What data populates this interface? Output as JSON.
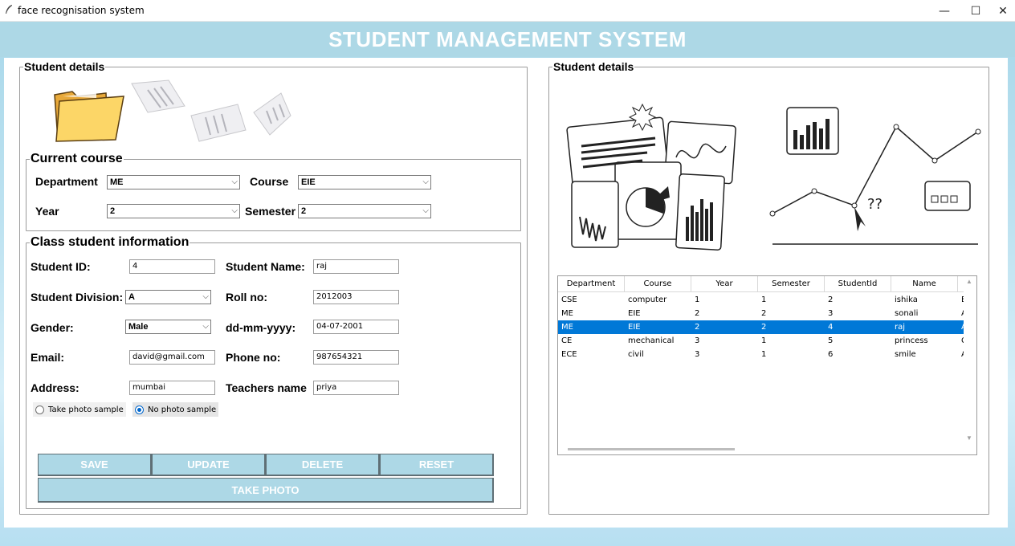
{
  "window": {
    "title": "face recognisation system",
    "controls": {
      "minimize": "—",
      "maximize": "☐",
      "close": "✕"
    }
  },
  "header": {
    "title": "STUDENT MANAGEMENT SYSTEM"
  },
  "left_panel": {
    "legend": "Student details",
    "current_course": {
      "legend": "Current course",
      "department_label": "Department",
      "department_value": "ME",
      "course_label": "Course",
      "course_value": "EIE",
      "year_label": "Year",
      "year_value": "2",
      "semester_label": "Semester",
      "semester_value": "2"
    },
    "class_info": {
      "legend": "Class student information",
      "student_id_label": "Student ID:",
      "student_id_value": "4",
      "student_name_label": "Student Name:",
      "student_name_value": "raj",
      "division_label": "Student Division:",
      "division_value": "A",
      "roll_label": "Roll no:",
      "roll_value": "2012003",
      "gender_label": "Gender:",
      "gender_value": "Male",
      "dob_label": "dd-mm-yyyy:",
      "dob_value": "04-07-2001",
      "email_label": "Email:",
      "email_value": "david@gmail.com",
      "phone_label": "Phone no:",
      "phone_value": "987654321",
      "address_label": "Address:",
      "address_value": "mumbai",
      "teacher_label": "Teachers name",
      "teacher_value": "priya",
      "radio_take": "Take photo sample",
      "radio_no": "No photo sample",
      "selected_radio": "No photo sample"
    },
    "buttons": {
      "save": "SAVE",
      "update": "UPDATE",
      "delete": "DELETE",
      "reset": "RESET",
      "take_photo": "TAKE PHOTO"
    }
  },
  "right_panel": {
    "legend": "Student details",
    "table": {
      "columns": [
        "Department",
        "Course",
        "Year",
        "Semester",
        "StudentId",
        "Name",
        ""
      ],
      "rows": [
        [
          "CSE",
          "computer",
          "1",
          "1",
          "2",
          "ishika",
          "E"
        ],
        [
          "ME",
          "EIE",
          "2",
          "2",
          "3",
          "sonali",
          "A"
        ],
        [
          "ME",
          "EIE",
          "2",
          "2",
          "4",
          "raj",
          "A"
        ],
        [
          "CE",
          "mechanical",
          "3",
          "1",
          "5",
          "princess",
          "C"
        ],
        [
          "ECE",
          "civil",
          "3",
          "1",
          "6",
          "smile",
          "A"
        ]
      ],
      "selected_row": 2
    }
  },
  "colors": {
    "header_bg": "#add8e6",
    "button_bg": "#add8e6",
    "selection": "#0078d7",
    "folder": "#f7c948"
  }
}
